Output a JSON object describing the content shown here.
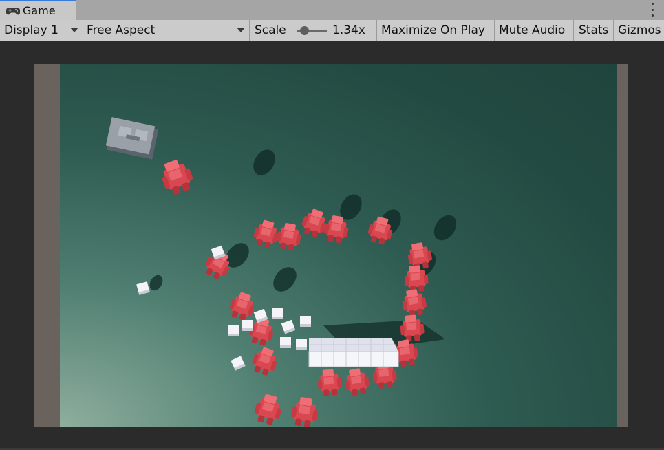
{
  "window": {
    "tab_title": "Game",
    "tab_icon": "gamepad-icon",
    "menu_icon": "kebab-menu-icon"
  },
  "toolbar": {
    "display": "Display 1",
    "aspect": "Free Aspect",
    "scale_label": "Scale",
    "scale_value": "1.34x",
    "scale_slider_fraction": 0.25,
    "maximize": "Maximize On Play",
    "mute": "Mute Audio",
    "stats": "Stats",
    "gizmos": "Gizmos"
  },
  "colors": {
    "tab_accent": "#3a79d8",
    "ground": "#2e5b51",
    "letterbox": "#6a625c",
    "robot_red": "#e0525a",
    "cube_white": "#f2f2f6",
    "tower_gray": "#8f959e"
  }
}
